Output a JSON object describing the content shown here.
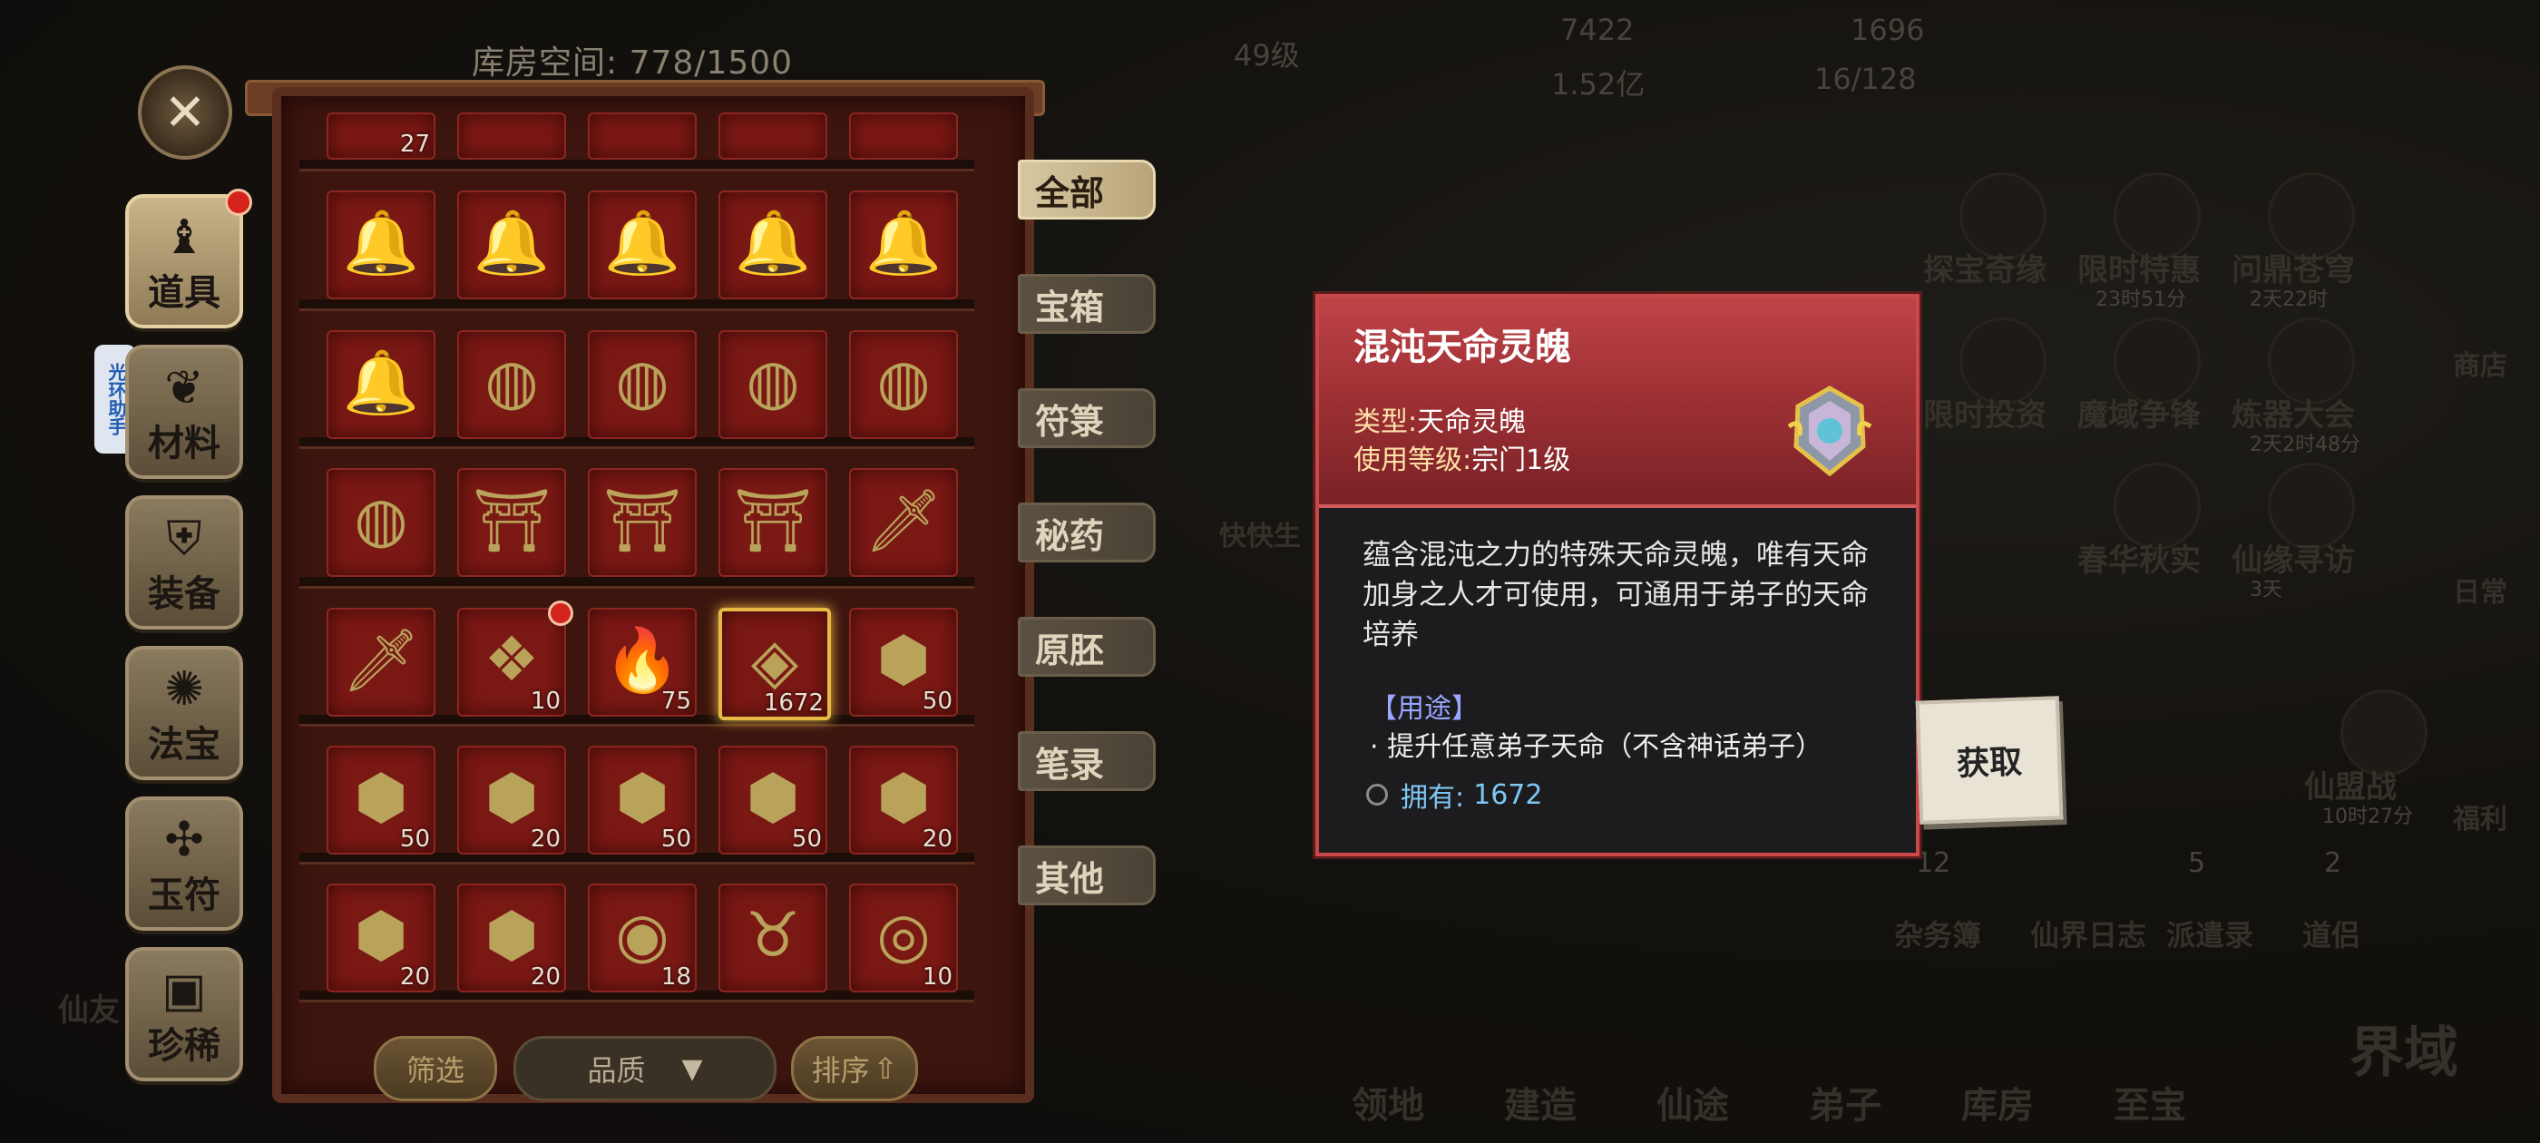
{
  "colors": {
    "card_border": "#c9484a",
    "slot_bg": "#7a1814",
    "selected_border": "#e7b944",
    "own_text": "#7ec7f4"
  },
  "background": {
    "top_stats": {
      "level": "49级",
      "copper": "7422",
      "coin": "1696",
      "spirit": "1.52亿",
      "slots": "16/128"
    },
    "quick_label": "快快生",
    "right_features": [
      {
        "name": "探宝奇缘",
        "icon": "treasure-hunt-icon"
      },
      {
        "name": "限时特惠",
        "icon": "sale-icon",
        "timer": "23时51分"
      },
      {
        "name": "问鼎苍穹",
        "icon": "sky-icon",
        "timer": "2天22时"
      },
      {
        "name": "限时投资",
        "icon": "invest-icon"
      },
      {
        "name": "魔域争锋",
        "icon": "demon-icon"
      },
      {
        "name": "炼器大会",
        "icon": "forge-icon",
        "timer": "2天2时48分"
      },
      {
        "name": "春华秋实",
        "icon": "harvest-icon"
      },
      {
        "name": "仙缘寻访",
        "icon": "visit-icon",
        "timer": "3天"
      },
      {
        "name": "仙盟战",
        "icon": "alliance-war-icon",
        "timer": "10时27分"
      }
    ],
    "right_column": [
      "商店",
      "日常",
      "福利"
    ],
    "bottom_nav": [
      "领地",
      "建造",
      "仙途",
      "弟子",
      "库房",
      "至宝"
    ],
    "bottom_row": [
      "杂务簿",
      "仙界日志",
      "派遣录",
      "道侣"
    ],
    "corner_label": "界域",
    "left_label": "仙友",
    "bottom_row_badges": {
      "杂务簿": "12",
      "派遣录": "5",
      "道侣": "2"
    }
  },
  "helper": "光环助手",
  "storage": {
    "label": "库房空间: 778/1500"
  },
  "side_tabs": [
    {
      "label": "道具",
      "icon": "bag-icon",
      "active": true,
      "dot": true
    },
    {
      "label": "材料",
      "icon": "leaf-icon",
      "active": false
    },
    {
      "label": "装备",
      "icon": "armor-icon",
      "active": false
    },
    {
      "label": "法宝",
      "icon": "magic-icon",
      "active": false
    },
    {
      "label": "玉符",
      "icon": "jade-icon",
      "active": false
    },
    {
      "label": "珍稀",
      "icon": "chest-icon",
      "active": false
    }
  ],
  "categories": [
    "全部",
    "宝箱",
    "符箓",
    "秘药",
    "原胚",
    "笔录",
    "其他"
  ],
  "active_category": "全部",
  "grid": {
    "partial_row": [
      "27",
      "",
      "",
      "",
      ""
    ],
    "rows": [
      [
        {
          "glyph": "🔔",
          "count": ""
        },
        {
          "glyph": "🔔",
          "count": ""
        },
        {
          "glyph": "🔔",
          "count": ""
        },
        {
          "glyph": "🔔",
          "count": ""
        },
        {
          "glyph": "🔔",
          "count": ""
        }
      ],
      [
        {
          "glyph": "🔔",
          "count": ""
        },
        {
          "glyph": "◍",
          "count": ""
        },
        {
          "glyph": "◍",
          "count": ""
        },
        {
          "glyph": "◍",
          "count": ""
        },
        {
          "glyph": "◍",
          "count": ""
        }
      ],
      [
        {
          "glyph": "◍",
          "count": ""
        },
        {
          "glyph": "⛩",
          "count": ""
        },
        {
          "glyph": "⛩",
          "count": ""
        },
        {
          "glyph": "⛩",
          "count": ""
        },
        {
          "glyph": "🗡",
          "count": ""
        }
      ],
      [
        {
          "glyph": "🗡",
          "count": ""
        },
        {
          "glyph": "❖",
          "count": "10",
          "dot": true
        },
        {
          "glyph": "🔥",
          "count": "75"
        },
        {
          "glyph": "◈",
          "count": "1672",
          "selected": true
        },
        {
          "glyph": "⬢",
          "count": "50"
        }
      ],
      [
        {
          "glyph": "⬢",
          "count": "50"
        },
        {
          "glyph": "⬢",
          "count": "20"
        },
        {
          "glyph": "⬢",
          "count": "50"
        },
        {
          "glyph": "⬢",
          "count": "50"
        },
        {
          "glyph": "⬢",
          "count": "20"
        }
      ],
      [
        {
          "glyph": "⬢",
          "count": "20"
        },
        {
          "glyph": "⬢",
          "count": "20"
        },
        {
          "glyph": "◉",
          "count": "18"
        },
        {
          "glyph": "♉",
          "count": ""
        },
        {
          "glyph": "◎",
          "count": "10"
        }
      ]
    ]
  },
  "filter_bar": {
    "filter": "筛选",
    "quality": "品质",
    "sort": "排序"
  },
  "detail": {
    "name": "混沌天命灵魄",
    "type_label": "类型:",
    "type_value": "天命灵魄",
    "level_label": "使用等级:",
    "level_value": "宗门1级",
    "description": "蕴含混沌之力的特殊天命灵魄，唯有天命加身之人才可使用，可通用于弟子的天命培养",
    "usage_header": "【用途】",
    "usage_item": "· 提升任意弟子天命（不含神话弟子）",
    "own_label": "拥有:",
    "own_value": "1672",
    "get_button": "获取"
  }
}
